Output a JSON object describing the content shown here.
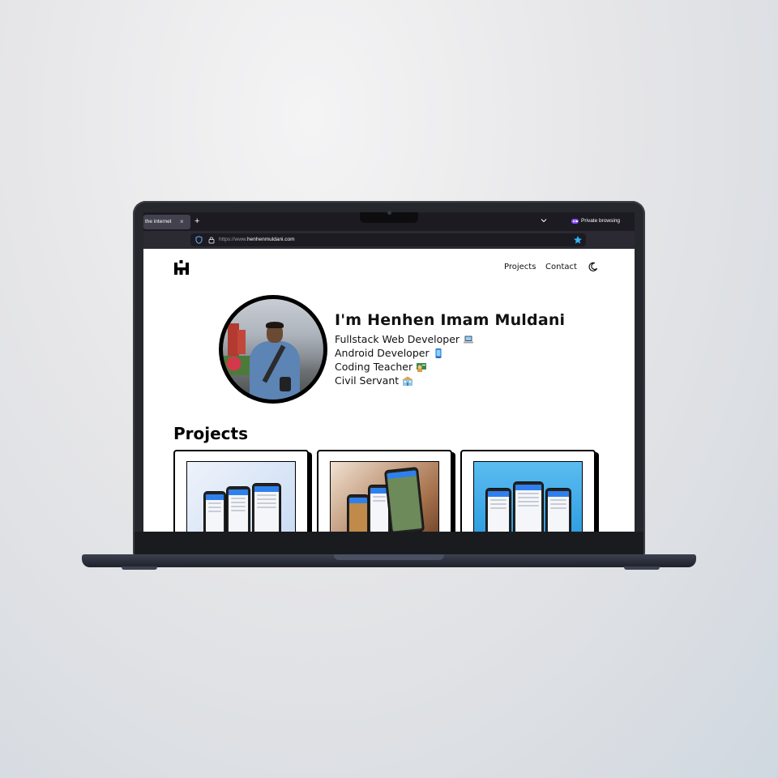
{
  "browser": {
    "tab_title": "the internet",
    "tab_close": "×",
    "new_tab": "+",
    "private_label": "Private browsing",
    "url_protocol": "https://www.",
    "url_domain": "henhenmuldani.com"
  },
  "site": {
    "nav": {
      "projects": "Projects",
      "contact": "Contact"
    },
    "hero": {
      "name": "I'm Henhen Imam Muldani",
      "roles": [
        {
          "label": "Fullstack Web Developer",
          "icon": "laptop-icon"
        },
        {
          "label": "Android Developer",
          "icon": "mobile-phone-icon"
        },
        {
          "label": "Coding Teacher",
          "icon": "teacher-icon"
        },
        {
          "label": "Civil Servant",
          "icon": "school-building-icon"
        }
      ]
    },
    "projects_title": "Projects",
    "project_cards": [
      {
        "image": "phone-mockups-blue",
        "bg": "#dfe8f5"
      },
      {
        "image": "phone-mockups-brown",
        "bg": "#a6714c"
      },
      {
        "image": "phone-mockups-lightblue",
        "bg": "#2b9be0"
      }
    ]
  },
  "colors": {
    "accent_blue": "#2f80ed",
    "private_purple": "#8a4dff",
    "star_blue": "#30b6ff",
    "laptop_body": "#25272c"
  }
}
